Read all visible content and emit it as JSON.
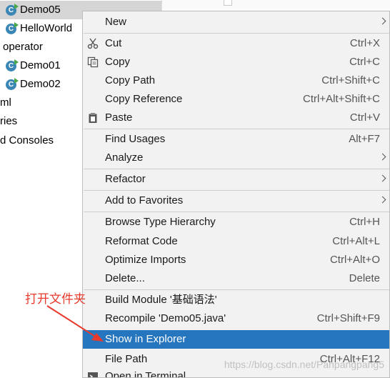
{
  "tree": {
    "items": [
      {
        "label": "Demo05",
        "icon": "class-icon",
        "selected": true
      },
      {
        "label": "HelloWorld",
        "icon": "class-icon"
      },
      {
        "label": "operator",
        "icon": "none"
      },
      {
        "label": "Demo01",
        "icon": "class-icon"
      },
      {
        "label": "Demo02",
        "icon": "class-icon"
      },
      {
        "label": "ml",
        "icon": "none"
      },
      {
        "label": "ries",
        "icon": "none"
      },
      {
        "label": "d Consoles",
        "icon": "none"
      }
    ]
  },
  "menu": {
    "new": {
      "label": "New"
    },
    "cut": {
      "label": "Cut",
      "shortcut": "Ctrl+X"
    },
    "copy": {
      "label": "Copy",
      "shortcut": "Ctrl+C"
    },
    "copy_path": {
      "label": "Copy Path",
      "shortcut": "Ctrl+Shift+C"
    },
    "copy_reference": {
      "label": "Copy Reference",
      "shortcut": "Ctrl+Alt+Shift+C"
    },
    "paste": {
      "label": "Paste",
      "shortcut": "Ctrl+V"
    },
    "find_usages": {
      "label": "Find Usages",
      "shortcut": "Alt+F7"
    },
    "analyze": {
      "label": "Analyze"
    },
    "refactor": {
      "label": "Refactor"
    },
    "add_to_favorites": {
      "label": "Add to Favorites"
    },
    "browse_type_hierarchy": {
      "label": "Browse Type Hierarchy",
      "shortcut": "Ctrl+H"
    },
    "reformat_code": {
      "label": "Reformat Code",
      "shortcut": "Ctrl+Alt+L"
    },
    "optimize_imports": {
      "label": "Optimize Imports",
      "shortcut": "Ctrl+Alt+O"
    },
    "delete": {
      "label": "Delete...",
      "shortcut": "Delete"
    },
    "build_module": {
      "label": "Build Module '基础语法'"
    },
    "recompile": {
      "label": "Recompile 'Demo05.java'",
      "shortcut": "Ctrl+Shift+F9"
    },
    "show_in_explorer": {
      "label": "Show in Explorer"
    },
    "file_path": {
      "label": "File Path",
      "shortcut": "Ctrl+Alt+F12"
    },
    "open_in_terminal": {
      "label": "Open in Terminal"
    }
  },
  "annotation": {
    "text": "打开文件夹",
    "color": "#e8392c"
  },
  "watermark": {
    "text": "https://blog.csdn.net/Panpangpang5"
  },
  "colors": {
    "highlight": "#2675bf",
    "menu_bg": "#f2f2f2",
    "tree_selected": "#d5d5d5"
  }
}
